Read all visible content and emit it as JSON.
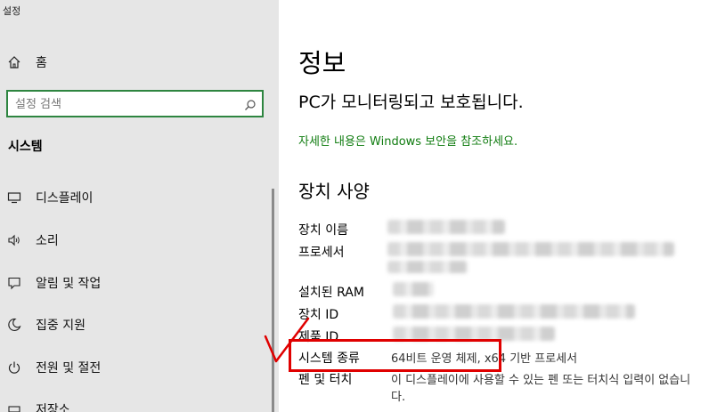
{
  "window": {
    "title": "설정"
  },
  "sidebar": {
    "home_label": "홈",
    "search_placeholder": "설정 검색",
    "section_title": "시스템",
    "items": [
      {
        "label": "디스플레이",
        "icon": "monitor-icon"
      },
      {
        "label": "소리",
        "icon": "speaker-icon"
      },
      {
        "label": "알림 및 작업",
        "icon": "notification-icon"
      },
      {
        "label": "집중 지원",
        "icon": "moon-icon"
      },
      {
        "label": "전원 및 절전",
        "icon": "power-icon"
      },
      {
        "label": "저장소",
        "icon": "storage-icon"
      }
    ]
  },
  "main": {
    "title": "정보",
    "protection_status": "PC가 모니터링되고 보호됩니다.",
    "security_link": "자세한 내용은 Windows 보안을 참조하세요.",
    "device_specs_heading": "장치 사양",
    "specs": [
      {
        "label": "장치 이름",
        "value": ""
      },
      {
        "label": "프로세서",
        "value": ""
      },
      {
        "label": "설치된 RAM",
        "value": ""
      },
      {
        "label": "장치 ID",
        "value": ""
      },
      {
        "label": "제품 ID",
        "value": ""
      },
      {
        "label": "시스템 종류",
        "value": "64비트 운영 체제, x64 기반 프로세서"
      },
      {
        "label": "펜 및 터치",
        "value": "이 디스플레이에 사용할 수 있는 펜 또는 터치식 입력이 없습니다."
      }
    ]
  },
  "colors": {
    "accent": "#107c10",
    "search_border": "#2e8540",
    "annotation": "#e00000",
    "sidebar_bg": "#e6e6e6"
  }
}
